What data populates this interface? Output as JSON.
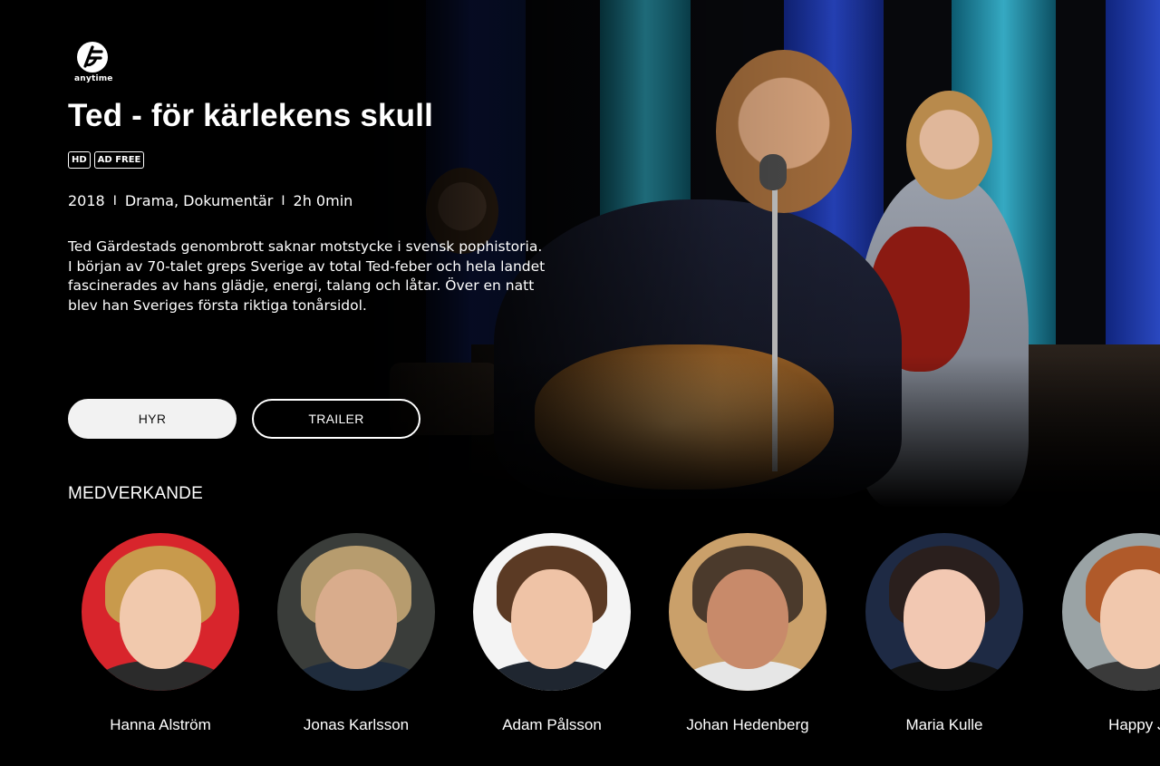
{
  "brand": {
    "logo_text": "anytime"
  },
  "movie": {
    "title": "Ted - för kärlekens skull",
    "badges": [
      "HD",
      "AD FREE"
    ],
    "year": "2018",
    "genres": "Drama, Dokumentär",
    "duration": "2h 0min",
    "separator": "I",
    "description": "Ted Gärdestads genombrott saknar motstycke i svensk pophistoria. I början av 70-talet greps Sverige av total Ted-feber och hela landet fascinerades av hans glädje, energi, talang och låtar. Över en natt blev han Sveriges första riktiga tonårsidol."
  },
  "actions": {
    "rent_label": "HYR",
    "trailer_label": "TRAILER"
  },
  "cast": {
    "heading": "MEDVERKANDE",
    "members": [
      {
        "name": "Hanna Alström",
        "bg": "#d8252c",
        "hair": "#c89a4c",
        "skin": "#f1c9ad",
        "top": "#2b2b2b"
      },
      {
        "name": "Jonas Karlsson",
        "bg": "#3a3d3a",
        "hair": "#b79c6e",
        "skin": "#d9ac8c",
        "top": "#1f2c3d"
      },
      {
        "name": "Adam Pålsson",
        "bg": "#f4f4f4",
        "hair": "#5b3a24",
        "skin": "#efc3a6",
        "top": "#1f2630"
      },
      {
        "name": "Johan Hedenberg",
        "bg": "#caa06a",
        "hair": "#4b3a2c",
        "skin": "#c88a6a",
        "top": "#e6e6e6"
      },
      {
        "name": "Maria Kulle",
        "bg": "#1e2a44",
        "hair": "#2a1f1d",
        "skin": "#f2c8b2",
        "top": "#111111"
      },
      {
        "name": "Happy Ja",
        "bg": "#9aa3a5",
        "hair": "#b05a2a",
        "skin": "#f1c8ad",
        "top": "#3a3a3a"
      }
    ]
  }
}
